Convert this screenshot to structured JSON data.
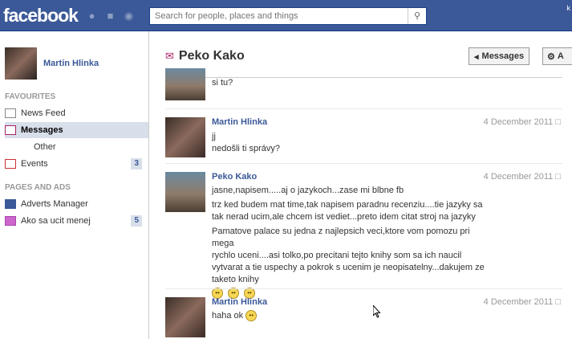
{
  "header": {
    "logo": "facebook",
    "search_placeholder": "Search for people, places and things",
    "corner_text": "k"
  },
  "sidebar": {
    "profile_name": "Martin Hlinka",
    "favourites_heading": "FAVOURITES",
    "items": [
      {
        "label": "News Feed"
      },
      {
        "label": "Messages"
      },
      {
        "label": "Other"
      },
      {
        "label": "Events",
        "badge": "3"
      }
    ],
    "pages_heading": "PAGES AND ADS",
    "pages": [
      {
        "label": "Adverts Manager"
      },
      {
        "label": "Ako sa ucit menej",
        "badge": "5"
      }
    ]
  },
  "conversation": {
    "title": "Peko Kako",
    "messages_button": "Messages",
    "actions_button": "A",
    "messages": [
      {
        "sender": "",
        "date": "",
        "lines": [
          "si tu?"
        ]
      },
      {
        "sender": "Martin Hlinka",
        "date": "4 December 2011",
        "lines": [
          "jj",
          "nedošli ti správy?"
        ]
      },
      {
        "sender": "Peko Kako",
        "date": "4 December 2011",
        "lines": [
          "jasne,napisem.....aj o jazykoch...zase mi blbne fb",
          "trz ked budem mat time,tak napisem paradnu recenziu....tie jazyky sa",
          "tak nerad ucim,ale chcem ist vediet...preto idem citat stroj na jazyky",
          "Pamatove palace su jedna z najlepsich veci,ktore vom pomozu pri mega",
          "rychlo uceni....asi tolko,po precitani tejto knihy som sa ich naucil",
          "vytvarat a tie uspechy a pokrok s ucenim je neopisatelny...dakujem ze",
          "taketo knihy"
        ]
      },
      {
        "sender": "Martin Hlinka",
        "date": "4 December 2011",
        "lines": [
          "haha ok"
        ]
      }
    ]
  }
}
